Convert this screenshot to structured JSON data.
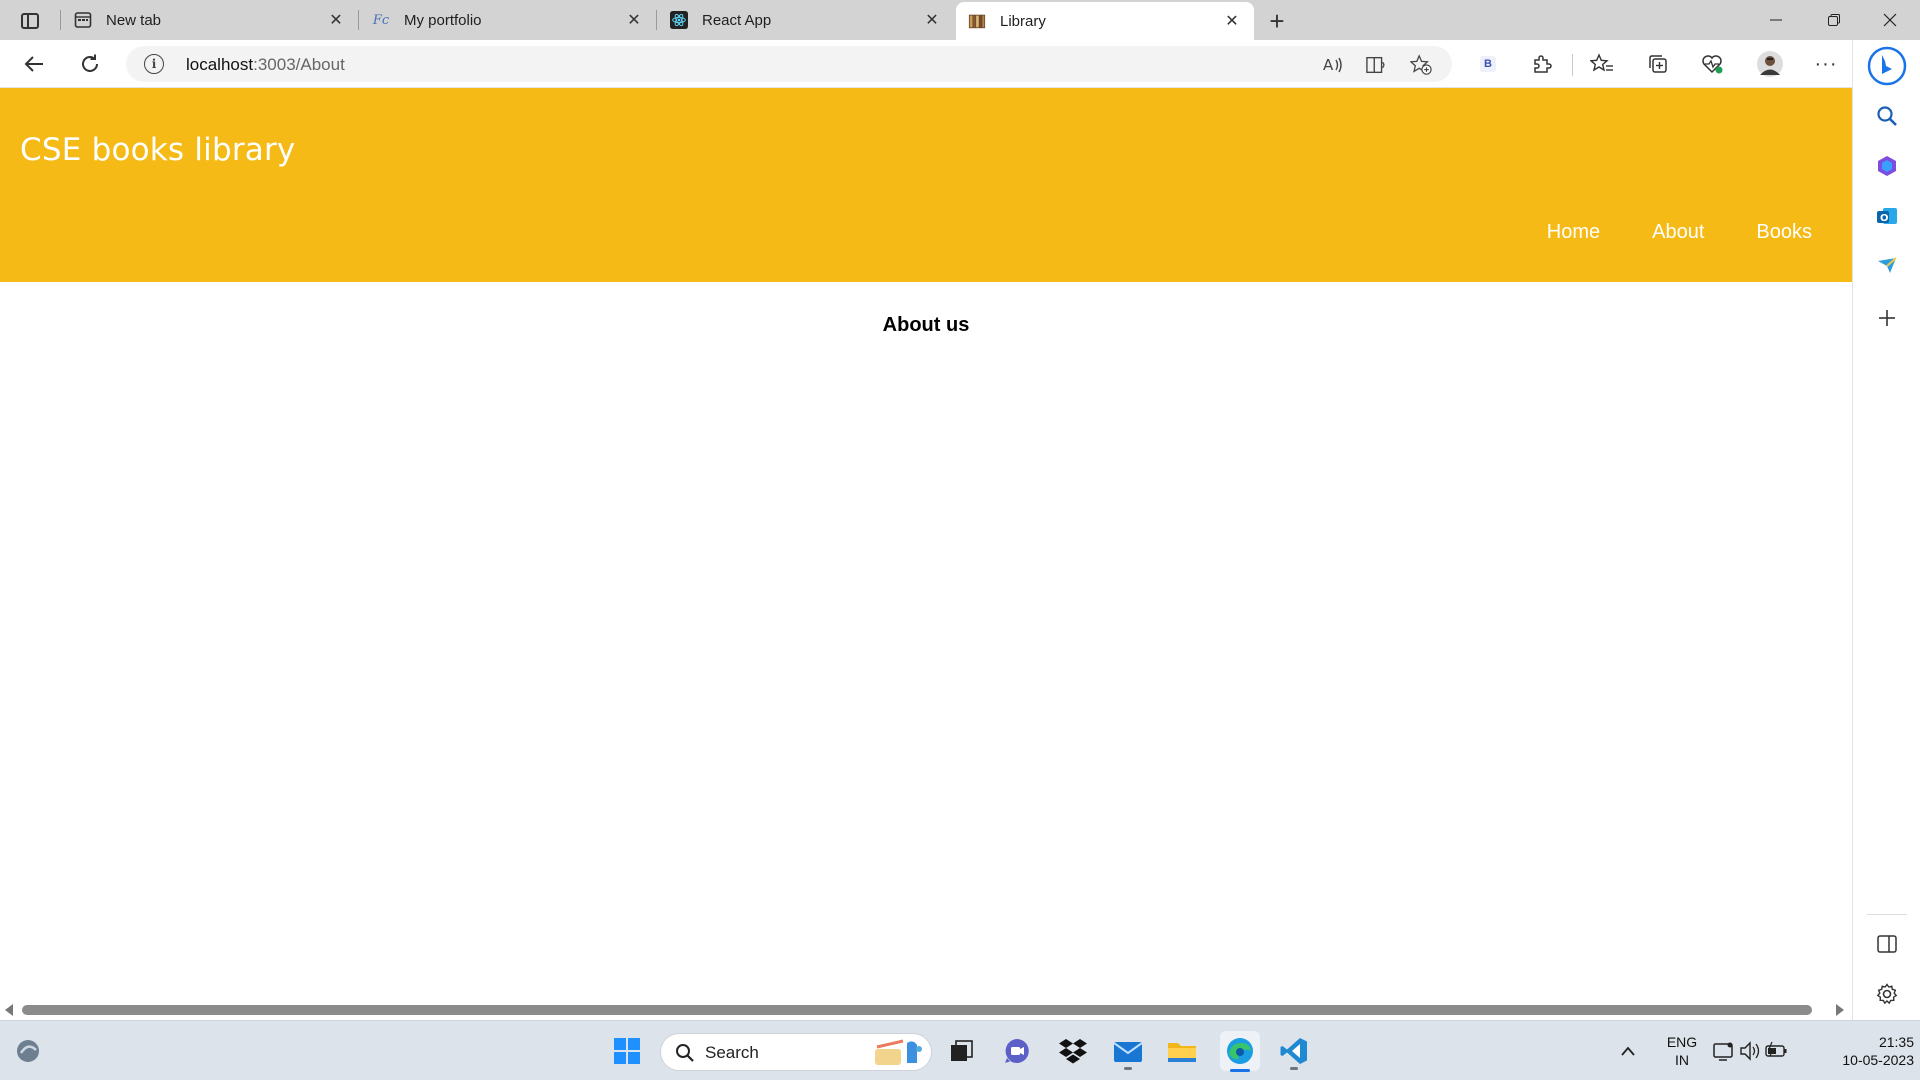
{
  "browser": {
    "tabs": [
      {
        "title": "New tab",
        "icon": "new-tab-icon"
      },
      {
        "title": "My portfolio",
        "icon": "portfolio-icon"
      },
      {
        "title": "React App",
        "icon": "react-icon"
      },
      {
        "title": "Library",
        "icon": "library-icon",
        "active": true
      }
    ],
    "address": {
      "host": "localhost",
      "path": ":3003/About"
    },
    "extension_badge": "B"
  },
  "site": {
    "brand": "CSE books library",
    "nav": [
      "Home",
      "About",
      "Books"
    ],
    "heading": "About us",
    "colors": {
      "header": "#f5ba15",
      "text": "#ffffff"
    }
  },
  "taskbar": {
    "search_label": "Search",
    "language_line1": "ENG",
    "language_line2": "IN",
    "time": "21:35",
    "date": "10-05-2023"
  }
}
